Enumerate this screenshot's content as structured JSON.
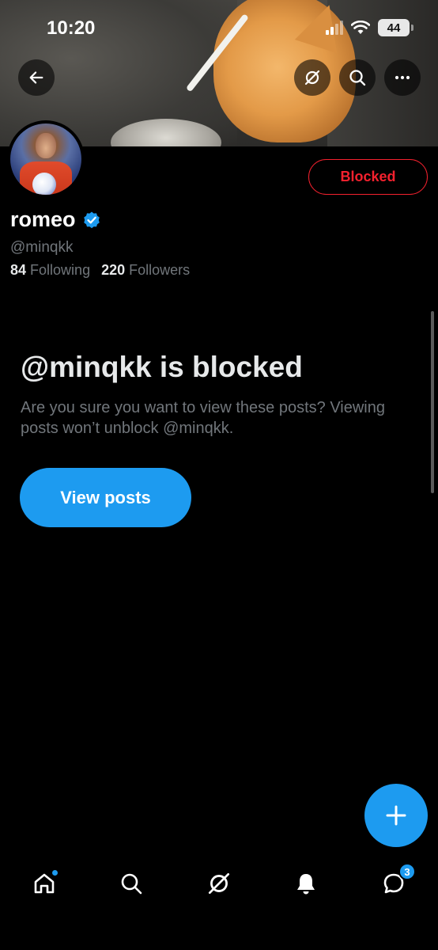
{
  "status_bar": {
    "time": "10:20",
    "battery": "44"
  },
  "profile": {
    "name": "romeo",
    "handle": "@minqkk",
    "following_count": "84",
    "following_label": "Following",
    "followers_count": "220",
    "followers_label": "Followers",
    "relationship_button": "Blocked"
  },
  "blocked_notice": {
    "title": "@minqkk is blocked",
    "description": "Are you sure you want to view these posts? Viewing posts won’t unblock @minqkk.",
    "view_posts_label": "View posts"
  },
  "bottom_nav": {
    "messages_badge": "3"
  },
  "colors": {
    "accent": "#1d9bf0",
    "blocked_red": "#f4212e",
    "muted": "#71767b",
    "background": "#000000"
  },
  "icons": [
    "back-arrow-icon",
    "grok-icon",
    "search-icon",
    "more-icon",
    "verified-badge-icon",
    "plus-icon",
    "home-icon",
    "bell-icon",
    "messages-icon"
  ]
}
